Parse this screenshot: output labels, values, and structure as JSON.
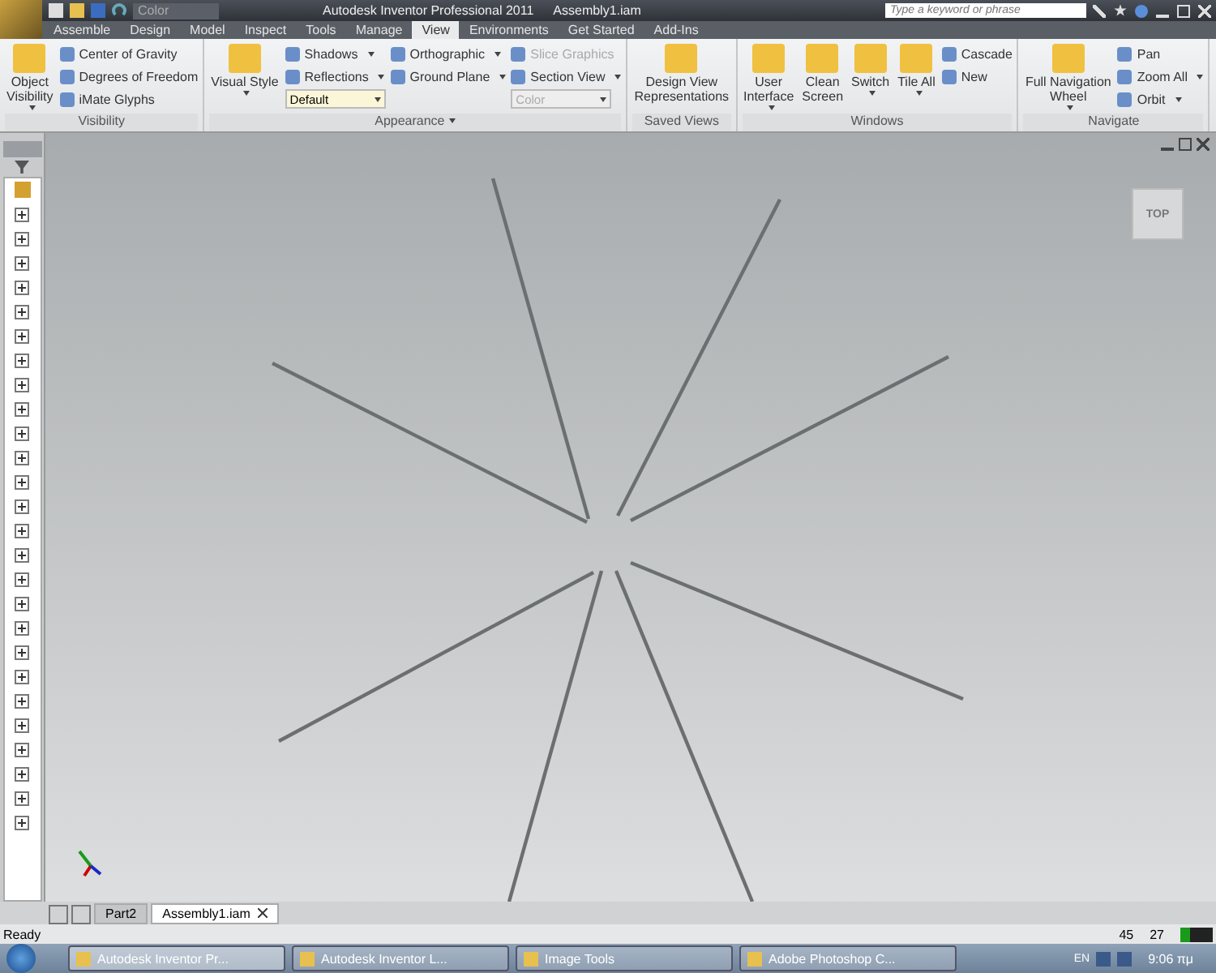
{
  "window": {
    "app_title": "Autodesk Inventor Professional 2011",
    "document": "Assembly1.iam"
  },
  "quick_access": {
    "color_combo": "Color"
  },
  "search": {
    "placeholder": "Type a keyword or phrase"
  },
  "tabs": [
    {
      "label": "Assemble",
      "selected": false
    },
    {
      "label": "Design",
      "selected": false
    },
    {
      "label": "Model",
      "selected": false
    },
    {
      "label": "Inspect",
      "selected": false
    },
    {
      "label": "Tools",
      "selected": false
    },
    {
      "label": "Manage",
      "selected": false
    },
    {
      "label": "View",
      "selected": true
    },
    {
      "label": "Environments",
      "selected": false
    },
    {
      "label": "Get Started",
      "selected": false
    },
    {
      "label": "Add-Ins",
      "selected": false
    }
  ],
  "ribbon_groups": [
    {
      "label": "Visibility",
      "has_menu": false,
      "columns": [
        [
          {
            "kind": "large",
            "label": "Object\nVisibility",
            "dropdown": true,
            "disabled": false
          }
        ],
        [
          {
            "kind": "small",
            "label": "Center of Gravity",
            "dropdown": false,
            "disabled": false
          },
          {
            "kind": "small",
            "label": "Degrees of Freedom",
            "dropdown": false,
            "disabled": false
          },
          {
            "kind": "small",
            "label": "iMate Glyphs",
            "dropdown": false,
            "disabled": false
          }
        ]
      ]
    },
    {
      "label": "Appearance",
      "has_menu": true,
      "columns": [
        [
          {
            "kind": "large",
            "label": "Visual Style",
            "dropdown": true,
            "disabled": false
          }
        ],
        [
          {
            "kind": "small",
            "label": "Shadows",
            "dropdown": true,
            "disabled": false
          },
          {
            "kind": "small",
            "label": "Reflections",
            "dropdown": true,
            "disabled": false
          },
          {
            "kind": "combo",
            "label": "Default",
            "dropdown": true,
            "disabled": false
          }
        ],
        [
          {
            "kind": "small",
            "label": "Orthographic",
            "dropdown": true,
            "disabled": false
          },
          {
            "kind": "small",
            "label": "Ground Plane",
            "dropdown": true,
            "disabled": false
          }
        ],
        [
          {
            "kind": "small",
            "label": "Slice Graphics",
            "dropdown": false,
            "disabled": true
          },
          {
            "kind": "small",
            "label": "Section View",
            "dropdown": true,
            "disabled": false
          },
          {
            "kind": "combo",
            "label": "Color",
            "dropdown": true,
            "disabled": true
          }
        ]
      ]
    },
    {
      "label": "Saved Views",
      "has_menu": false,
      "columns": [
        [
          {
            "kind": "large",
            "label": "Design View\nRepresentations",
            "dropdown": false,
            "disabled": false
          }
        ]
      ]
    },
    {
      "label": "Windows",
      "has_menu": false,
      "columns": [
        [
          {
            "kind": "large",
            "label": "User\nInterface",
            "dropdown": true,
            "disabled": false
          }
        ],
        [
          {
            "kind": "large",
            "label": "Clean\nScreen",
            "dropdown": false,
            "disabled": false
          }
        ],
        [
          {
            "kind": "large",
            "label": "Switch",
            "dropdown": true,
            "disabled": false
          }
        ],
        [
          {
            "kind": "large",
            "label": "Tile All",
            "dropdown": true,
            "disabled": false
          }
        ],
        [
          {
            "kind": "small",
            "label": "Cascade",
            "dropdown": false,
            "disabled": false
          },
          {
            "kind": "small",
            "label": "New",
            "dropdown": false,
            "disabled": false
          }
        ]
      ]
    },
    {
      "label": "Navigate",
      "has_menu": false,
      "columns": [
        [
          {
            "kind": "large",
            "label": "Full Navigation\nWheel",
            "dropdown": true,
            "disabled": false
          }
        ],
        [
          {
            "kind": "small",
            "label": "Pan",
            "dropdown": false,
            "disabled": false
          },
          {
            "kind": "small",
            "label": "Zoom All",
            "dropdown": true,
            "disabled": false
          },
          {
            "kind": "small",
            "label": "Orbit",
            "dropdown": true,
            "disabled": false
          }
        ]
      ]
    }
  ],
  "viewcube": {
    "label": "TOP"
  },
  "document_tabs": [
    {
      "label": "Part2",
      "selected": false
    },
    {
      "label": "Assembly1.iam",
      "selected": true
    }
  ],
  "status_bar": {
    "message": "Ready",
    "count_1": "45",
    "count_2": "27"
  },
  "taskbar": {
    "items": [
      {
        "label": "Autodesk Inventor Pr...",
        "selected": true
      },
      {
        "label": "Autodesk Inventor L...",
        "selected": false
      },
      {
        "label": "Image Tools",
        "selected": false
      },
      {
        "label": "Adobe Photoshop C...",
        "selected": false
      }
    ],
    "language": "EN",
    "clock": "9:06 πμ"
  }
}
